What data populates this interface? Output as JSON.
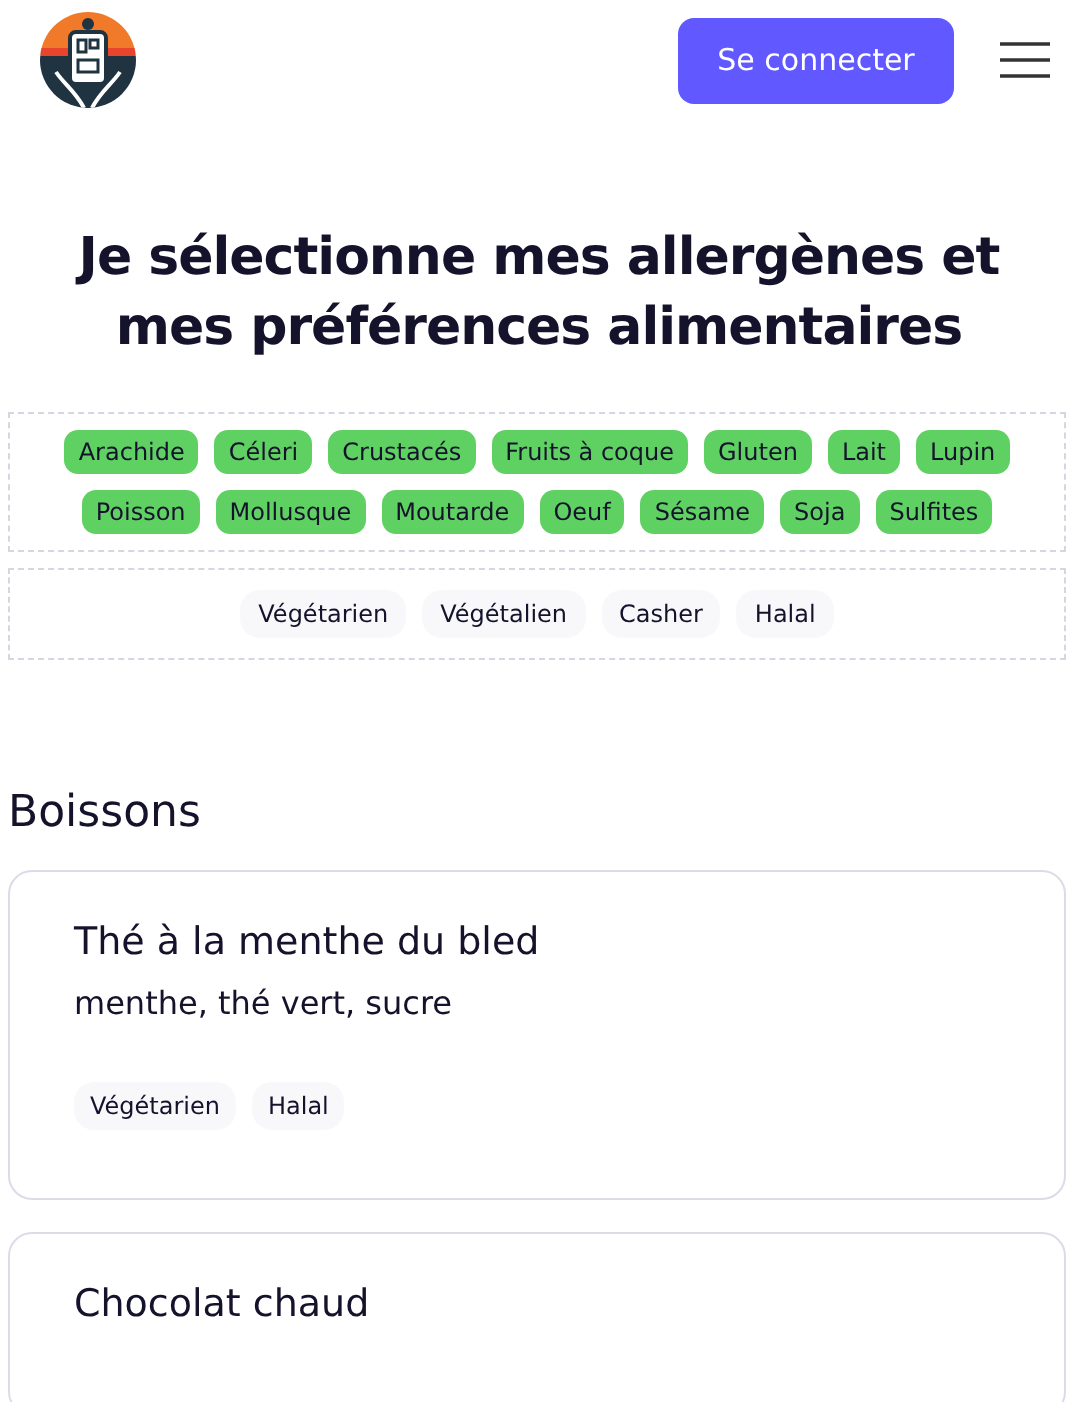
{
  "header": {
    "login_button": "Se connecter"
  },
  "title": "Je sélectionne mes allergènes et mes préférences alimentaires",
  "allergens": [
    {
      "label": "Arachide",
      "selected": true
    },
    {
      "label": "Céleri",
      "selected": true
    },
    {
      "label": "Crustacés",
      "selected": true
    },
    {
      "label": "Fruits à coque",
      "selected": true
    },
    {
      "label": "Gluten",
      "selected": true
    },
    {
      "label": "Lait",
      "selected": true
    },
    {
      "label": "Lupin",
      "selected": true
    },
    {
      "label": "Poisson",
      "selected": true
    },
    {
      "label": "Mollusque",
      "selected": true
    },
    {
      "label": "Moutarde",
      "selected": true
    },
    {
      "label": "Oeuf",
      "selected": true
    },
    {
      "label": "Sésame",
      "selected": true
    },
    {
      "label": "Soja",
      "selected": true
    },
    {
      "label": "Sulfites",
      "selected": true
    }
  ],
  "preferences": [
    {
      "label": "Végétarien",
      "selected": false
    },
    {
      "label": "Végétalien",
      "selected": false
    },
    {
      "label": "Casher",
      "selected": false
    },
    {
      "label": "Halal",
      "selected": false
    }
  ],
  "section_title": "Boissons",
  "dishes": [
    {
      "name": "Thé à la menthe du bled",
      "ingredients": "menthe, thé vert, sucre",
      "tags": [
        "Végétarien",
        "Halal"
      ]
    },
    {
      "name": "Chocolat chaud"
    }
  ]
}
